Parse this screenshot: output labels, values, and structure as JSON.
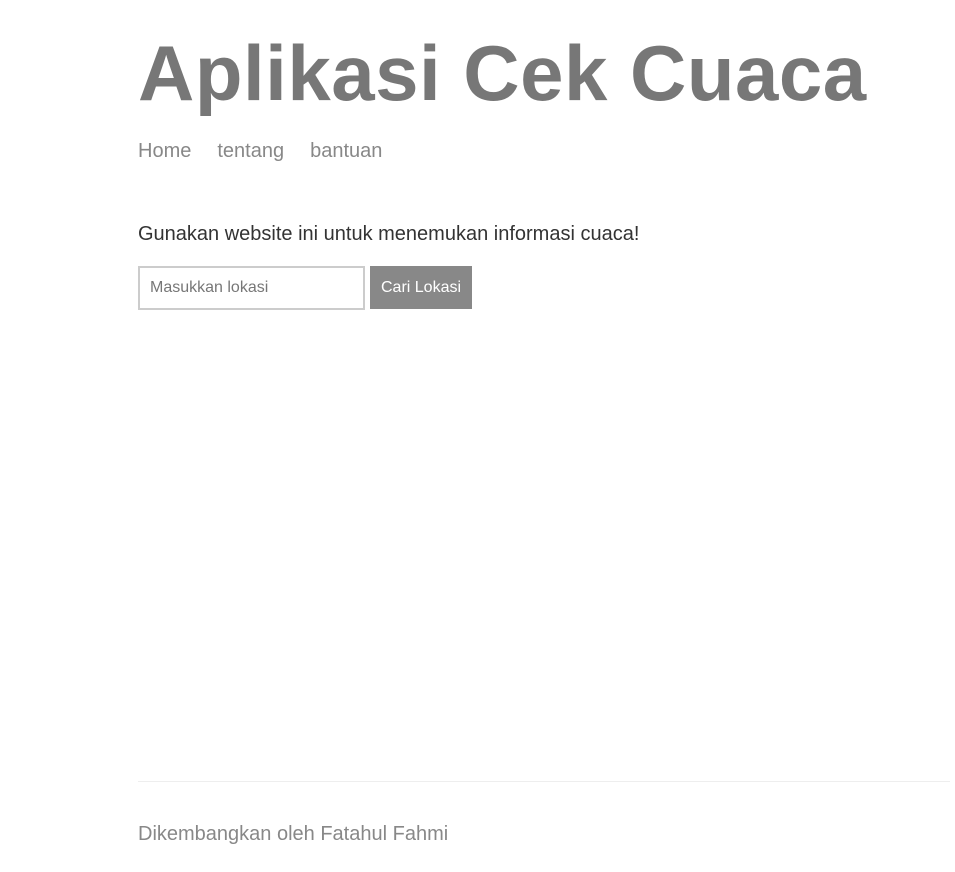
{
  "header": {
    "title": "Aplikasi Cek Cuaca",
    "nav": [
      {
        "label": "Home"
      },
      {
        "label": "tentang"
      },
      {
        "label": "bantuan"
      }
    ]
  },
  "main": {
    "intro": "Gunakan website ini untuk menemukan informasi cuaca!",
    "search": {
      "placeholder": "Masukkan lokasi",
      "value": "",
      "button_label": "Cari Lokasi"
    }
  },
  "footer": {
    "text": "Dikembangkan oleh Fatahul Fahmi"
  },
  "colors": {
    "title": "#777777",
    "nav_link": "#888888",
    "button_bg": "#888888",
    "button_text": "#ffffff",
    "input_border": "#cccccc",
    "body_text": "#333333"
  }
}
